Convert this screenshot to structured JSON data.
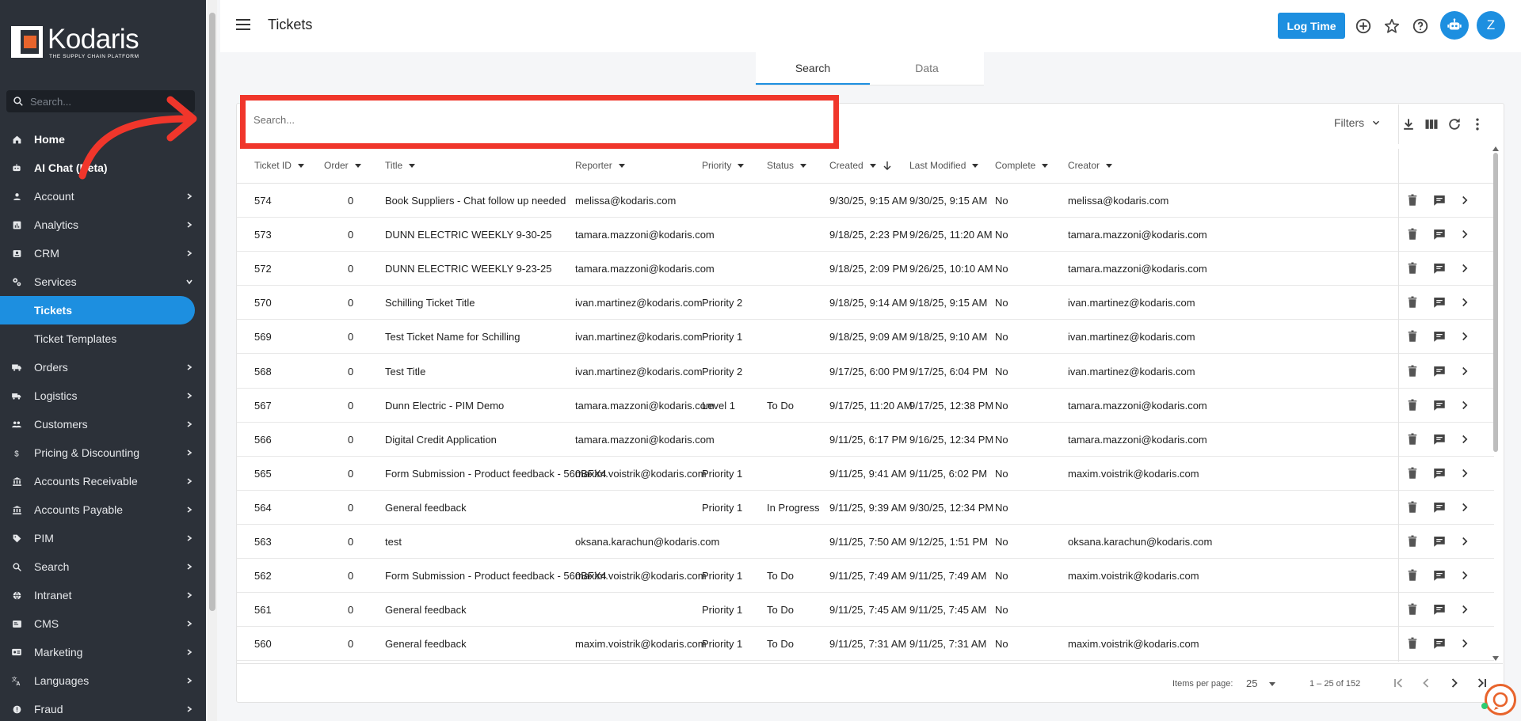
{
  "brand": {
    "name": "Kodaris",
    "tagline": "THE SUPPLY CHAIN PLATFORM"
  },
  "sidebar": {
    "search_placeholder": "Search...",
    "items": [
      {
        "label": "Home",
        "icon": "home-icon",
        "bold": true,
        "chevron": false
      },
      {
        "label": "AI Chat (Beta)",
        "icon": "robot-icon",
        "bold": true,
        "chevron": false
      },
      {
        "label": "Account",
        "icon": "user-icon",
        "chevron": true
      },
      {
        "label": "Analytics",
        "icon": "chart-icon",
        "chevron": true
      },
      {
        "label": "CRM",
        "icon": "contacts-icon",
        "chevron": true
      },
      {
        "label": "Services",
        "icon": "gears-icon",
        "chevron": true,
        "expanded": true
      },
      {
        "label": "Tickets",
        "sub": true,
        "active": true
      },
      {
        "label": "Ticket Templates",
        "sub": true
      },
      {
        "label": "Orders",
        "icon": "truck-icon",
        "chevron": true
      },
      {
        "label": "Logistics",
        "icon": "shipping-icon",
        "chevron": true
      },
      {
        "label": "Customers",
        "icon": "people-icon",
        "chevron": true
      },
      {
        "label": "Pricing & Discounting",
        "icon": "dollar-icon",
        "chevron": true
      },
      {
        "label": "Accounts Receivable",
        "icon": "bank-icon",
        "chevron": true
      },
      {
        "label": "Accounts Payable",
        "icon": "bank-icon",
        "chevron": true
      },
      {
        "label": "PIM",
        "icon": "tag-icon",
        "chevron": true
      },
      {
        "label": "Search",
        "icon": "search-icon",
        "chevron": true
      },
      {
        "label": "Intranet",
        "icon": "globe-icon",
        "chevron": true
      },
      {
        "label": "CMS",
        "icon": "cms-icon",
        "chevron": true
      },
      {
        "label": "Marketing",
        "icon": "megaphone-icon",
        "chevron": true
      },
      {
        "label": "Languages",
        "icon": "translate-icon",
        "chevron": true
      },
      {
        "label": "Fraud",
        "icon": "alert-icon",
        "chevron": true
      }
    ]
  },
  "header": {
    "title": "Tickets",
    "log_time": "Log Time",
    "avatar_initial": "Z"
  },
  "tabs": [
    "Search",
    "Data"
  ],
  "search": {
    "placeholder": "Search...",
    "filters_label": "Filters"
  },
  "table": {
    "columns": [
      "Ticket ID",
      "Order",
      "Title",
      "Reporter",
      "Priority",
      "Status",
      "Created",
      "Last Modified",
      "Complete",
      "Creator"
    ],
    "rows": [
      [
        "574",
        "0",
        "Book Suppliers - Chat follow up needed",
        "melissa@kodaris.com",
        "",
        "",
        "9/30/25, 9:15 AM",
        "9/30/25, 9:15 AM",
        "No",
        "melissa@kodaris.com"
      ],
      [
        "573",
        "0",
        "DUNN ELECTRIC WEEKLY 9-30-25",
        "tamara.mazzoni@kodaris.com",
        "",
        "",
        "9/18/25, 2:23 PM",
        "9/26/25, 11:20 AM",
        "No",
        "tamara.mazzoni@kodaris.com"
      ],
      [
        "572",
        "0",
        "DUNN ELECTRIC WEEKLY 9-23-25",
        "tamara.mazzoni@kodaris.com",
        "",
        "",
        "9/18/25, 2:09 PM",
        "9/26/25, 10:10 AM",
        "No",
        "tamara.mazzoni@kodaris.com"
      ],
      [
        "570",
        "0",
        "Schilling Ticket Title",
        "ivan.martinez@kodaris.com",
        "Priority 2",
        "",
        "9/18/25, 9:14 AM",
        "9/18/25, 9:15 AM",
        "No",
        "ivan.martinez@kodaris.com"
      ],
      [
        "569",
        "0",
        "Test Ticket Name for Schilling",
        "ivan.martinez@kodaris.com",
        "Priority 1",
        "",
        "9/18/25, 9:09 AM",
        "9/18/25, 9:10 AM",
        "No",
        "ivan.martinez@kodaris.com"
      ],
      [
        "568",
        "0",
        "Test Title",
        "ivan.martinez@kodaris.com",
        "Priority 2",
        "",
        "9/17/25, 6:00 PM",
        "9/17/25, 6:04 PM",
        "No",
        "ivan.martinez@kodaris.com"
      ],
      [
        "567",
        "0",
        "Dunn Electric - PIM Demo",
        "tamara.mazzoni@kodaris.com",
        "Level 1",
        "To Do",
        "9/17/25, 11:20 AM",
        "9/17/25, 12:38 PM",
        "No",
        "tamara.mazzoni@kodaris.com"
      ],
      [
        "566",
        "0",
        "Digital Credit Application",
        "tamara.mazzoni@kodaris.com",
        "",
        "",
        "9/11/25, 6:17 PM",
        "9/16/25, 12:34 PM",
        "No",
        "tamara.mazzoni@kodaris.com"
      ],
      [
        "565",
        "0",
        "Form Submission - Product feedback - 560BFX4",
        "maxim.voistrik@kodaris.com",
        "Priority 1",
        "",
        "9/11/25, 9:41 AM",
        "9/11/25, 6:02 PM",
        "No",
        "maxim.voistrik@kodaris.com"
      ],
      [
        "564",
        "0",
        "General feedback",
        "",
        "Priority 1",
        "In Progress",
        "9/11/25, 9:39 AM",
        "9/30/25, 12:34 PM",
        "No",
        ""
      ],
      [
        "563",
        "0",
        "test",
        "oksana.karachun@kodaris.com",
        "",
        "",
        "9/11/25, 7:50 AM",
        "9/12/25, 1:51 PM",
        "No",
        "oksana.karachun@kodaris.com"
      ],
      [
        "562",
        "0",
        "Form Submission - Product feedback - 560BFX4",
        "maxim.voistrik@kodaris.com",
        "Priority 1",
        "To Do",
        "9/11/25, 7:49 AM",
        "9/11/25, 7:49 AM",
        "No",
        "maxim.voistrik@kodaris.com"
      ],
      [
        "561",
        "0",
        "General feedback",
        "",
        "Priority 1",
        "To Do",
        "9/11/25, 7:45 AM",
        "9/11/25, 7:45 AM",
        "No",
        ""
      ],
      [
        "560",
        "0",
        "General feedback",
        "maxim.voistrik@kodaris.com",
        "Priority 1",
        "To Do",
        "9/11/25, 7:31 AM",
        "9/11/25, 7:31 AM",
        "No",
        "maxim.voistrik@kodaris.com"
      ]
    ]
  },
  "pagination": {
    "items_per_page_label": "Items per page:",
    "items_per_page": "25",
    "range": "1 – 25 of 152"
  },
  "colors": {
    "accent": "#1d8fe0",
    "sidebar_bg": "#2c3139",
    "highlight": "#f0362b",
    "logo_orange": "#e8642c"
  }
}
